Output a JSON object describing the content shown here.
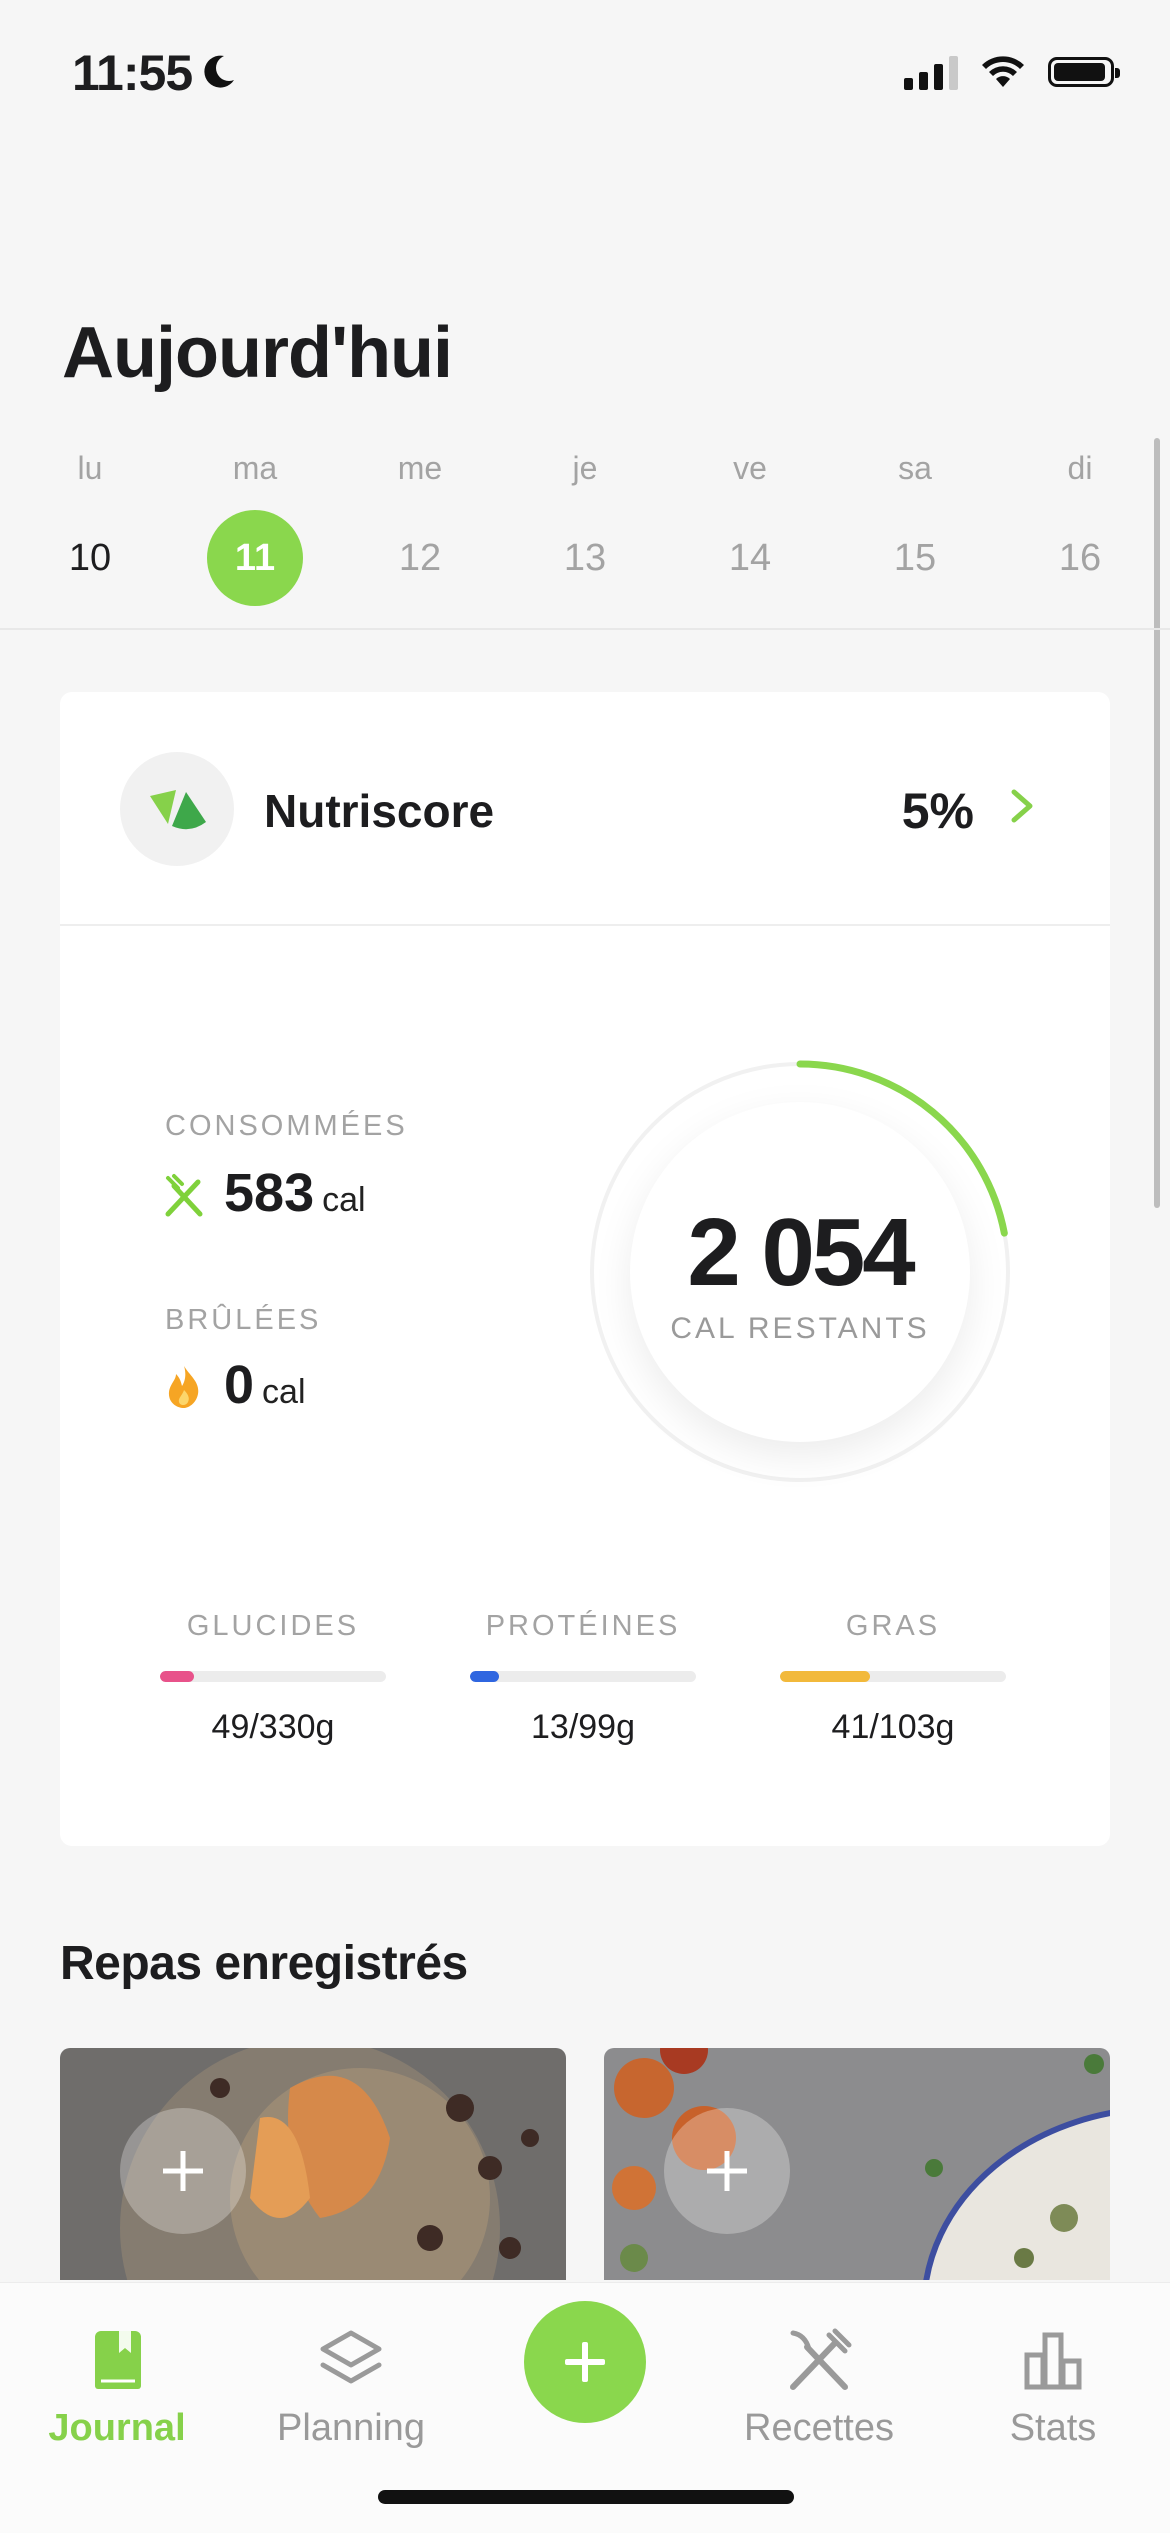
{
  "status_bar": {
    "time": "11:55"
  },
  "header": {
    "title": "Aujourd'hui"
  },
  "week": [
    {
      "name": "lu",
      "date": "10",
      "state": "past"
    },
    {
      "name": "ma",
      "date": "11",
      "state": "active"
    },
    {
      "name": "me",
      "date": "12",
      "state": "future"
    },
    {
      "name": "je",
      "date": "13",
      "state": "future"
    },
    {
      "name": "ve",
      "date": "14",
      "state": "future"
    },
    {
      "name": "sa",
      "date": "15",
      "state": "future"
    },
    {
      "name": "di",
      "date": "16",
      "state": "future"
    }
  ],
  "nutriscore": {
    "label": "Nutriscore",
    "value": "5%"
  },
  "summary": {
    "consumed_label": "CONSOMMÉES",
    "consumed_value": "583",
    "consumed_unit": "cal",
    "burned_label": "BRÛLÉES",
    "burned_value": "0",
    "burned_unit": "cal",
    "remaining_value": "2 054",
    "remaining_label": "CAL RESTANTS",
    "remaining_progress": 0.22
  },
  "macros": [
    {
      "label": "GLUCIDES",
      "value": "49/330g",
      "progress": 0.15,
      "color": "#e8528a"
    },
    {
      "label": "PROTÉINES",
      "value": "13/99g",
      "progress": 0.13,
      "color": "#2f66e0"
    },
    {
      "label": "GRAS",
      "value": "41/103g",
      "progress": 0.4,
      "color": "#f2b93b"
    }
  ],
  "meals": {
    "title": "Repas enregistrés"
  },
  "tabs": {
    "journal": "Journal",
    "planning": "Planning",
    "recettes": "Recettes",
    "stats": "Stats"
  },
  "colors": {
    "accent": "#8ad74d",
    "accent_text": "#86d14a"
  }
}
